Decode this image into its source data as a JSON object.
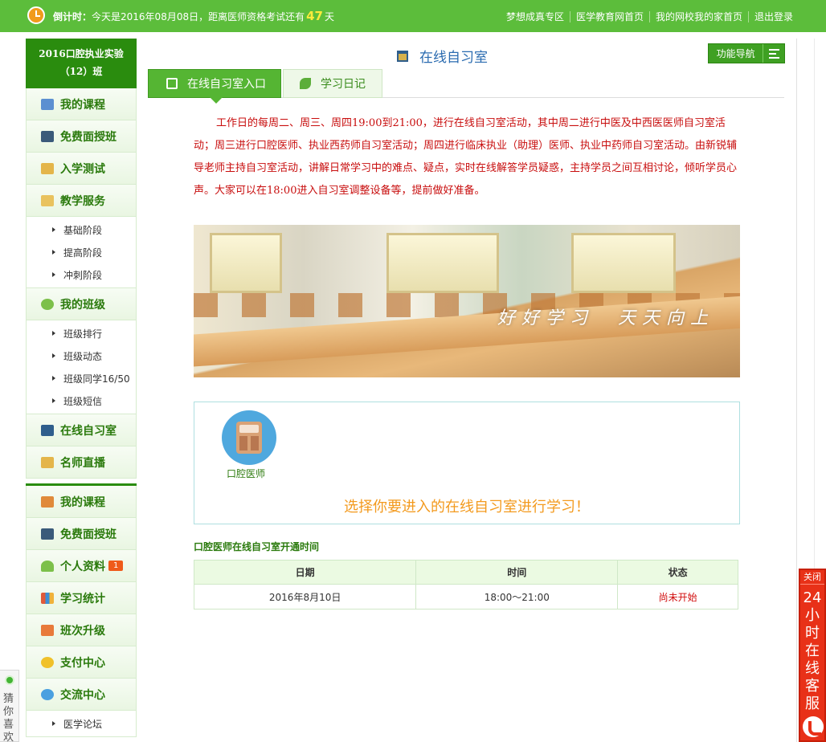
{
  "topbar": {
    "countdown_label": "倒计时：",
    "countdown_text": "今天是2016年08月08日，距离医师资格考试还有",
    "days": "47",
    "days_unit": "天",
    "links": [
      "梦想成真专区",
      "医学教育网首页",
      "我的网校我的家首页",
      "退出登录"
    ]
  },
  "sidebar": {
    "class_name": "2016口腔执业实验（12）班",
    "group1": {
      "my_course": "我的课程",
      "free_class": "免费面授班",
      "entrance_test": "入学测试",
      "teaching_service": "教学服务",
      "teaching_sub": [
        "基础阶段",
        "提高阶段",
        "冲刺阶段"
      ],
      "my_class": "我的班级",
      "class_sub": [
        "班级排行",
        "班级动态",
        "班级同学16/50",
        "班级短信"
      ],
      "study_room": "在线自习室",
      "live": "名师直播"
    },
    "group2": {
      "my_course": "我的课程",
      "free_class": "免费面授班",
      "profile": "个人资料",
      "profile_badge": "1",
      "stats": "学习统计",
      "upgrade": "班次升级",
      "payment": "支付中心",
      "community": "交流中心",
      "community_sub": [
        "医学论坛"
      ]
    }
  },
  "main": {
    "title": "在线自习室",
    "function_nav": "功能导航",
    "tabs": [
      "在线自习室入口",
      "学习日记"
    ],
    "intro": "工作日的每周二、周三、周四19:00到21:00，进行在线自习室活动，其中周二进行中医及中西医医师自习室活动；周三进行口腔医师、执业西药师自习室活动；周四进行临床执业（助理）医师、执业中药师自习室活动。由新锐辅导老师主持自习室活动，讲解日常学习中的难点、疑点，实时在线解答学员疑惑，主持学员之间互相讨论，倾听学员心声。大家可以在18:00进入自习室调整设备等，提前做好准备。",
    "banner_slogan": "好好学习　天天向上",
    "room_label": "口腔医师",
    "room_cta": "选择你要进入的在线自习室进行学习！",
    "schedule_title": "口腔医师在线自习室开通时间",
    "schedule_headers": [
      "日期",
      "时间",
      "状态"
    ],
    "schedule_rows": [
      [
        "2016年8月10日",
        "18:00～21:00",
        "尚未开始"
      ]
    ]
  },
  "service": {
    "close": "关闭",
    "text": "24小时在线客服"
  },
  "guess": "猜你喜欢",
  "colors": {
    "brand_green": "#5cbd3b",
    "dark_green": "#2a8c0e",
    "alert_red": "#c80d0d",
    "cta_orange": "#f39a1e"
  }
}
